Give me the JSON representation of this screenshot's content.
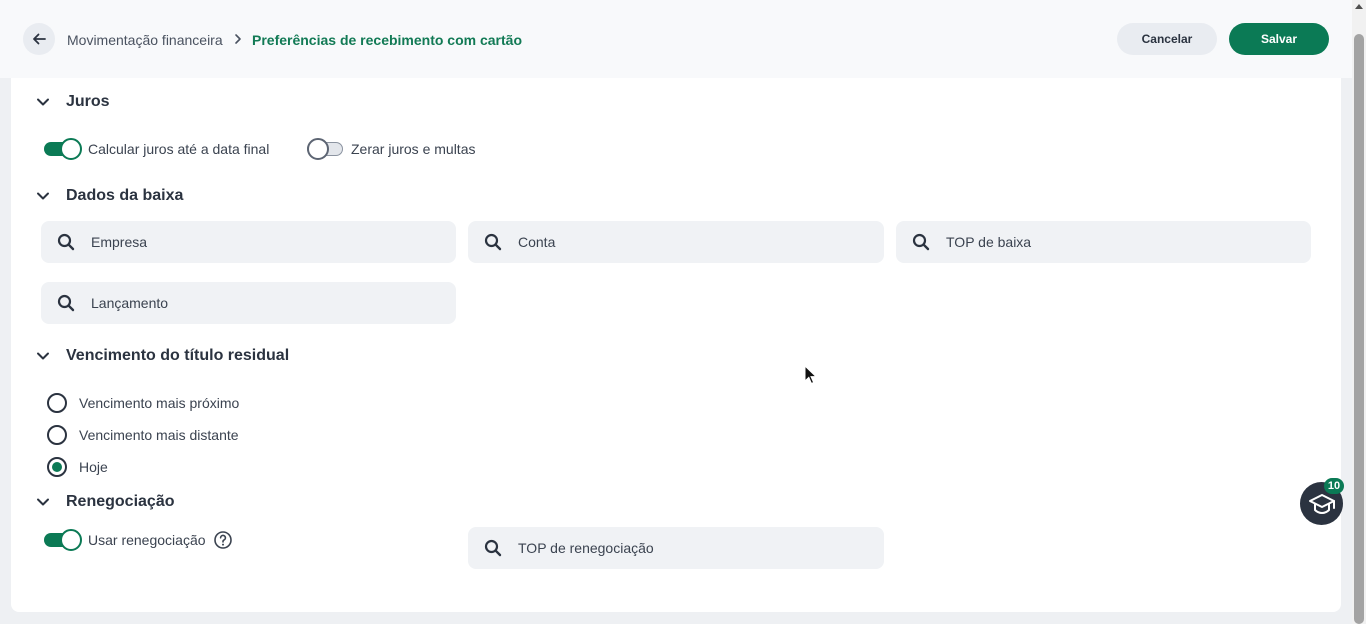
{
  "header": {
    "breadcrumb_parent": "Movimentação financeira",
    "breadcrumb_current": "Preferências de recebimento com cartão",
    "cancel_label": "Cancelar",
    "save_label": "Salvar"
  },
  "sections": {
    "juros": {
      "title": "Juros",
      "toggle_calcular": {
        "label": "Calcular juros até a data final",
        "on": true
      },
      "toggle_zerar": {
        "label": "Zerar juros e multas",
        "on": false
      }
    },
    "dados_baixa": {
      "title": "Dados da baixa",
      "empresa_placeholder": "Empresa",
      "conta_placeholder": "Conta",
      "top_baixa_placeholder": "TOP de baixa",
      "lancamento_placeholder": "Lançamento"
    },
    "vencimento": {
      "title": "Vencimento do título residual",
      "options": [
        "Vencimento mais próximo",
        "Vencimento mais distante",
        "Hoje"
      ],
      "selected": "Hoje"
    },
    "renegociacao": {
      "title": "Renegociação",
      "toggle_usar": {
        "label": "Usar renegociação",
        "on": true
      },
      "top_renegociacao_placeholder": "TOP de renegociação"
    }
  },
  "help_fab": {
    "badge": "10"
  },
  "colors": {
    "primary": "#0b7a55",
    "text": "#2b3340",
    "field_bg": "#f0f2f5"
  },
  "icons": [
    "arrow-left-icon",
    "chevron-right-icon",
    "chevron-down-icon",
    "search-icon",
    "question-circle-icon",
    "graduation-cap-icon"
  ]
}
